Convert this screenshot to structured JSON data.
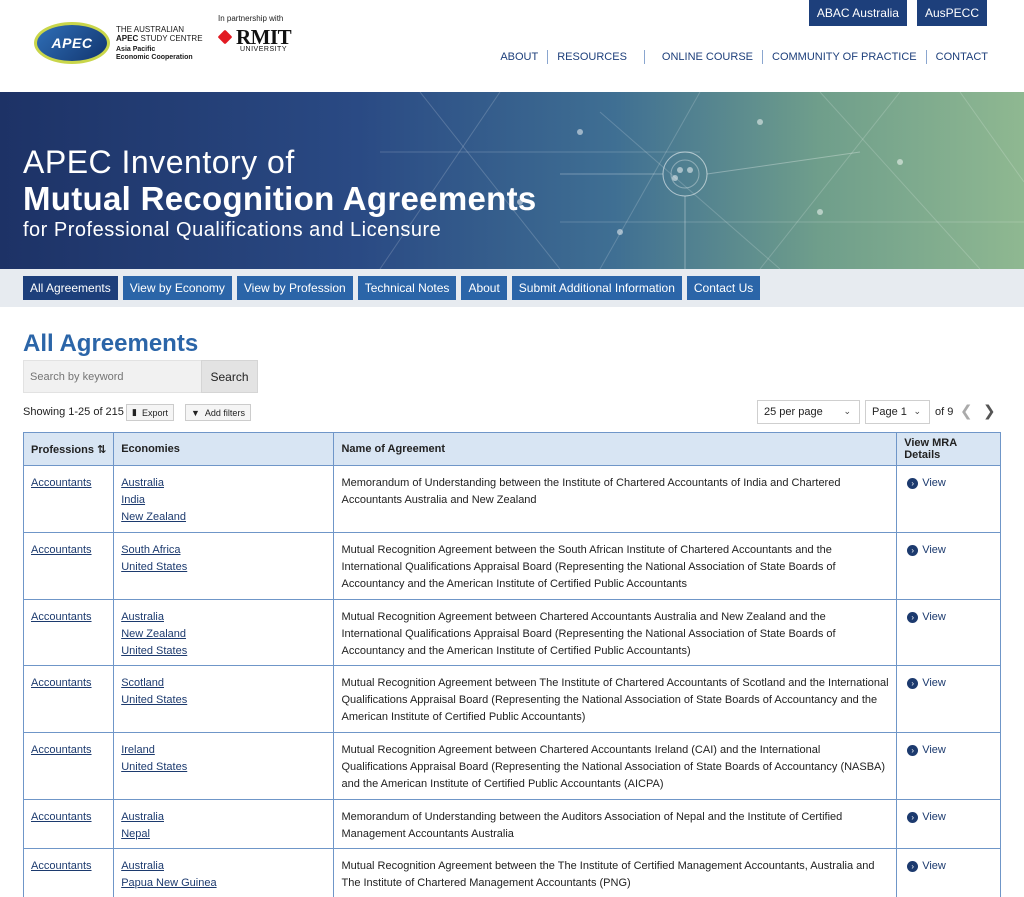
{
  "header": {
    "logo": {
      "mark": "APEC",
      "line1": "THE AUSTRALIAN",
      "line2_bold": "APEC",
      "line2_rest": " STUDY CENTRE",
      "line3": "Asia Pacific",
      "line4": "Economic Cooperation"
    },
    "partner_text": "In partnership with",
    "partner_name": "RMIT",
    "partner_sub": "UNIVERSITY",
    "top_buttons": [
      "ABAC Australia",
      "AusPECC"
    ],
    "nav": [
      "ABOUT",
      "RESOURCES",
      "ONLINE COURSE",
      "COMMUNITY OF PRACTICE",
      "CONTACT"
    ]
  },
  "banner": {
    "line1": "APEC Inventory of",
    "line2": "Mutual Recognition Agreements",
    "line3": "for Professional Qualifications and Licensure"
  },
  "subnav": [
    "All Agreements",
    "View by Economy",
    "View by Profession",
    "Technical Notes",
    "About",
    "Submit Additional Information",
    "Contact Us"
  ],
  "content": {
    "title": "All Agreements",
    "search_placeholder": "Search by keyword",
    "search_button": "Search",
    "showing": "Showing 1-25 of 215",
    "export": "Export",
    "add_filters": "Add filters",
    "per_page": "25 per page",
    "page": "Page 1",
    "of_pages": "of 9"
  },
  "table": {
    "headers": [
      "Professions",
      "Economies",
      "Name of Agreement",
      "View MRA Details"
    ],
    "rows": [
      {
        "profession": "Accountants",
        "economies": [
          "Australia",
          "India",
          "New Zealand"
        ],
        "name": "Memorandum of Understanding between the Institute of Chartered Accountants of India and Chartered Accountants Australia and New Zealand",
        "view": "View"
      },
      {
        "profession": "Accountants",
        "economies": [
          "South Africa",
          "United States"
        ],
        "name": "Mutual Recognition Agreement between the South African Institute of Chartered Accountants and the International Qualifications Appraisal Board (Representing the National Association of State Boards of Accountancy and the American Institute of Certified Public Accountants",
        "view": "View"
      },
      {
        "profession": "Accountants",
        "economies": [
          "Australia",
          "New Zealand",
          "United States"
        ],
        "name": "Mutual Recognition Agreement between Chartered Accountants Australia and New Zealand and the International Qualifications Appraisal Board (Representing the National Association of State Boards of Accountancy and the American Institute of Certified Public Accountants)",
        "view": "View"
      },
      {
        "profession": "Accountants",
        "economies": [
          "Scotland",
          "United States"
        ],
        "name": "Mutual Recognition Agreement between The Institute of Chartered Accountants of Scotland and the International Qualifications Appraisal Board (Representing the National Association of State Boards of Accountancy and the American Institute of Certified Public Accountants)",
        "view": "View"
      },
      {
        "profession": "Accountants",
        "economies": [
          "Ireland",
          "United States"
        ],
        "name": "Mutual Recognition Agreement between Chartered Accountants Ireland (CAI) and the International Qualifications Appraisal Board (Representing the National Association of State Boards of Accountancy (NASBA) and the American Institute of Certified Public Accountants (AICPA)",
        "view": "View"
      },
      {
        "profession": "Accountants",
        "economies": [
          "Australia",
          "Nepal"
        ],
        "name": "Memorandum of Understanding between the Auditors Association of Nepal and the Institute of Certified Management Accountants Australia",
        "view": "View"
      },
      {
        "profession": "Accountants",
        "economies": [
          "Australia",
          "Papua New Guinea"
        ],
        "name": "Mutual Recognition Agreement between the The Institute of Certified Management Accountants, Australia and The Institute of Chartered Management Accountants (PNG)",
        "view": "View"
      }
    ]
  }
}
